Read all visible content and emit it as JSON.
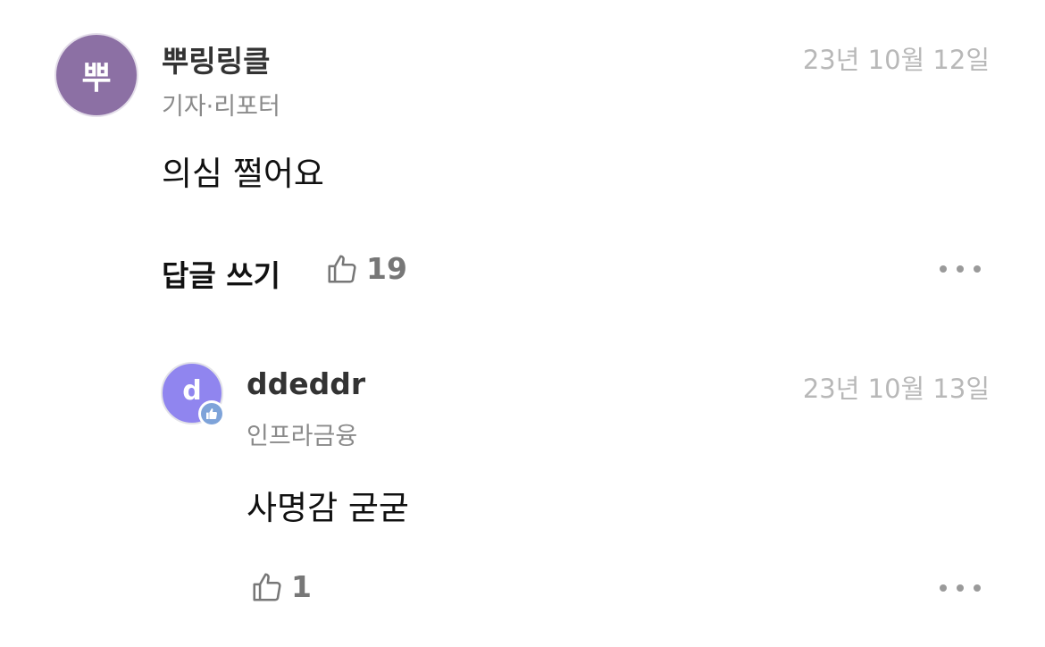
{
  "comment": {
    "avatar_text": "뿌",
    "avatar_color": "#8c70a4",
    "nickname": "뿌링링클",
    "role": "기자·리포터",
    "date": "23년 10월 12일",
    "text": "의심 쩔어요",
    "reply_label": "답글 쓰기",
    "like_count": "19",
    "like_icon": "thumbs-up-icon",
    "more_icon": "more-horizontal-icon"
  },
  "reply": {
    "avatar_text": "d",
    "avatar_color": "#9085ef",
    "badge_icon": "thumbs-up-badge-icon",
    "badge_color": "#7ea3d9",
    "nickname": "ddeddr",
    "role": "인프라금융",
    "date": "23년 10월 13일",
    "text": "사명감 굳굳",
    "like_count": "1",
    "like_icon": "thumbs-up-icon",
    "more_icon": "more-horizontal-icon"
  }
}
